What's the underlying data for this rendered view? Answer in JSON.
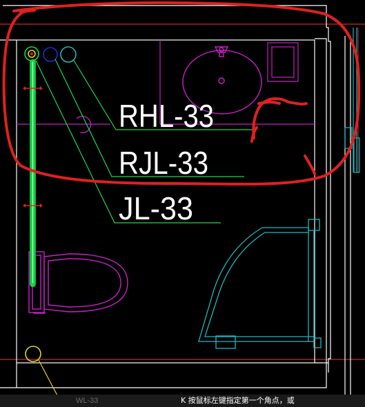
{
  "drawing": {
    "pipe_labels": {
      "rhl": "RHL-33",
      "rjl": "RJL-33",
      "jl": "JL-33"
    },
    "colors": {
      "wall": "#ffffff",
      "grid_red": "#d0262b",
      "pipe_green": "#19d94a",
      "fixture_magenta": "#c91fc9",
      "shower_cyan": "#19b9c4",
      "annotation_red": "#e02020",
      "valve_yellow": "#e6d21a",
      "valve_blue": "#1f2fcf"
    }
  },
  "command_bar": {
    "ghost_text": "WL-33",
    "prompt": "K 按鼠标左键指定第一个角点，或"
  }
}
